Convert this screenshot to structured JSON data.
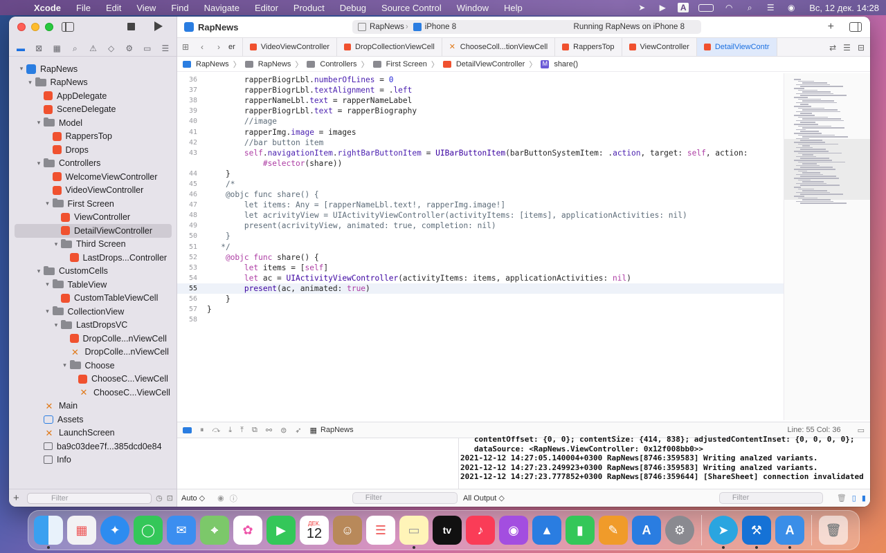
{
  "menubar": {
    "app": "Xcode",
    "items": [
      "File",
      "Edit",
      "View",
      "Find",
      "Navigate",
      "Editor",
      "Product",
      "Debug",
      "Source Control",
      "Window",
      "Help"
    ],
    "clock": "Вс, 12 дек.  14:28",
    "input_source": "A"
  },
  "window": {
    "project_title": "RapNews",
    "scheme": "RapNews",
    "device": "iPhone 8",
    "status": "Running RapNews on iPhone 8"
  },
  "tabs": [
    "er",
    "VideoViewController",
    "DropCollectionViewCell",
    "ChooseColl...tionViewCell",
    "RappersTop",
    "ViewController",
    "DetailViewContr"
  ],
  "breadcrumb": [
    "RapNews",
    "RapNews",
    "Controllers",
    "First Screen",
    "DetailViewController",
    "share()"
  ],
  "navigator": [
    {
      "label": "RapNews",
      "icon": "project",
      "depth": 0,
      "disc": "▾"
    },
    {
      "label": "RapNews",
      "icon": "folder",
      "depth": 1,
      "disc": "▾"
    },
    {
      "label": "AppDelegate",
      "icon": "swift",
      "depth": 2,
      "disc": ""
    },
    {
      "label": "SceneDelegate",
      "icon": "swift",
      "depth": 2,
      "disc": ""
    },
    {
      "label": "Model",
      "icon": "folder",
      "depth": 2,
      "disc": "▾"
    },
    {
      "label": "RappersTop",
      "icon": "swift",
      "depth": 3,
      "disc": ""
    },
    {
      "label": "Drops",
      "icon": "swift",
      "depth": 3,
      "disc": ""
    },
    {
      "label": "Controllers",
      "icon": "folder",
      "depth": 2,
      "disc": "▾"
    },
    {
      "label": "WelcomeViewController",
      "icon": "swift",
      "depth": 3,
      "disc": ""
    },
    {
      "label": "VideoViewController",
      "icon": "swift",
      "depth": 3,
      "disc": ""
    },
    {
      "label": "First Screen",
      "icon": "folder",
      "depth": 3,
      "disc": "▾"
    },
    {
      "label": "ViewController",
      "icon": "swift",
      "depth": 4,
      "disc": ""
    },
    {
      "label": "DetailViewController",
      "icon": "swift",
      "depth": 4,
      "disc": "",
      "selected": true
    },
    {
      "label": "Third Screen",
      "icon": "folder",
      "depth": 4,
      "disc": "▾"
    },
    {
      "label": "LastDrops...Controller",
      "icon": "swift",
      "depth": 5,
      "disc": ""
    },
    {
      "label": "CustomCells",
      "icon": "folder",
      "depth": 2,
      "disc": "▾"
    },
    {
      "label": "TableView",
      "icon": "folder",
      "depth": 3,
      "disc": "▾"
    },
    {
      "label": "CustomTableViewCell",
      "icon": "swift",
      "depth": 4,
      "disc": ""
    },
    {
      "label": "CollectionView",
      "icon": "folder",
      "depth": 3,
      "disc": "▾"
    },
    {
      "label": "LastDropsVC",
      "icon": "folder",
      "depth": 4,
      "disc": "▾"
    },
    {
      "label": "DropColle...nViewCell",
      "icon": "swift",
      "depth": 5,
      "disc": ""
    },
    {
      "label": "DropColle...nViewCell",
      "icon": "xib",
      "depth": 5,
      "disc": ""
    },
    {
      "label": "Choose",
      "icon": "folder",
      "depth": 5,
      "disc": "▾"
    },
    {
      "label": "ChooseC...ViewCell",
      "icon": "swift",
      "depth": 6,
      "disc": ""
    },
    {
      "label": "ChooseC...ViewCell",
      "icon": "xib",
      "depth": 6,
      "disc": ""
    },
    {
      "label": "Main",
      "icon": "xib",
      "depth": 2,
      "disc": ""
    },
    {
      "label": "Assets",
      "icon": "assets",
      "depth": 2,
      "disc": ""
    },
    {
      "label": "LaunchScreen",
      "icon": "xib",
      "depth": 2,
      "disc": ""
    },
    {
      "label": "ba9c03dee7f...385dcd0e84",
      "icon": "data",
      "depth": 2,
      "disc": ""
    },
    {
      "label": "Info",
      "icon": "plist",
      "depth": 2,
      "disc": ""
    }
  ],
  "sidebar_filter": {
    "placeholder": "Filter"
  },
  "code_lines": [
    {
      "n": "36",
      "html": "        rapperBiogrLbl.<span class='pr'>numberOfLines</span> = <span class='nm'>0</span>"
    },
    {
      "n": "37",
      "html": "        rapperBiogrLbl.<span class='pr'>textAlignment</span> = .<span class='pr'>left</span>"
    },
    {
      "n": "38",
      "html": "        rapperNameLbl.<span class='pr'>text</span> = rapperNameLabel"
    },
    {
      "n": "39",
      "html": "        rapperBiogrLbl.<span class='pr'>text</span> = rapperBiography"
    },
    {
      "n": "40",
      "html": "        <span class='cm'>//image</span>"
    },
    {
      "n": "41",
      "html": "        rapperImg.<span class='pr'>image</span> = images"
    },
    {
      "n": "42",
      "html": "        <span class='cm'>//bar button item</span>"
    },
    {
      "n": "43",
      "html": "        <span class='kw'>self</span>.<span class='pr'>navigationItem</span>.<span class='pr'>rightBarButtonItem</span> = <span class='ty'>UIBarButtonItem</span>(barButtonSystemItem: .<span class='pr'>action</span>, target: <span class='kw'>self</span>, action:"
    },
    {
      "n": "",
      "html": "            <span class='kw'>#selector</span>(share))"
    },
    {
      "n": "44",
      "html": "    }"
    },
    {
      "n": "45",
      "html": "    <span class='cm'>/*</span>"
    },
    {
      "n": "46",
      "html": "<span class='cm'>    @objc func share() {</span>"
    },
    {
      "n": "47",
      "html": "<span class='cm'>        let items: Any = [rapperNameLbl.text!, rapperImg.image!]</span>"
    },
    {
      "n": "48",
      "html": "<span class='cm'>        let acrivityView = UIActivityViewController(activityItems: [items], applicationActivities: nil)</span>"
    },
    {
      "n": "49",
      "html": "<span class='cm'>        present(acrivityView, animated: true, completion: nil)</span>"
    },
    {
      "n": "50",
      "html": "<span class='cm'>    }</span>"
    },
    {
      "n": "51",
      "html": "<span class='cm'>   */</span>"
    },
    {
      "n": "52",
      "html": "    <span class='kw'>@objc</span> <span class='kw'>func</span> share() {"
    },
    {
      "n": "53",
      "html": "        <span class='kw'>let</span> items = [<span class='kw'>self</span>]"
    },
    {
      "n": "54",
      "html": "        <span class='kw'>let</span> ac = <span class='ty'>UIActivityViewController</span>(activityItems: items, applicationActivities: <span class='kw'>nil</span>)"
    },
    {
      "n": "55",
      "html": "        <span class='ty'>present</span>(ac, animated: <span class='kw'>true</span>)",
      "current": true
    },
    {
      "n": "56",
      "html": "    }"
    },
    {
      "n": "57",
      "html": "}"
    },
    {
      "n": "58",
      "html": ""
    }
  ],
  "debug_bar": {
    "process": "RapNews",
    "line_col": "Line: 55  Col: 36"
  },
  "console_lines": [
    "   contentOffset: {0, 0}; contentSize: {414, 838}; adjustedContentInset: {0, 0, 0, 0};",
    "   dataSource: <RapNews.ViewController: 0x12f008bb0>>",
    "2021-12-12 14:27:05.140004+0300 RapNews[8746:359583] Writing analzed variants.",
    "2021-12-12 14:27:23.249923+0300 RapNews[8746:359583] Writing analzed variants.",
    "2021-12-12 14:27:23.777852+0300 RapNews[8746:359644] [ShareSheet] connection invalidated"
  ],
  "bottom_bar": {
    "auto_label": "Auto ◇",
    "filter_placeholder": "Filter",
    "output_label": "All Output ◇",
    "console_filter": "Filter"
  },
  "dock": {
    "calendar_month": "ДЕК.",
    "calendar_day": "12",
    "tv_label": "tv"
  }
}
